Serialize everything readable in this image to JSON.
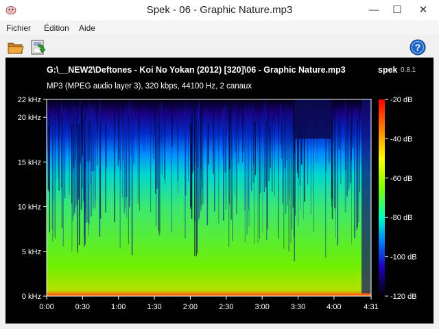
{
  "window": {
    "title": "Spek - 06 - Graphic Nature.mp3",
    "minimize_glyph": "—",
    "maximize_glyph": "☐",
    "close_glyph": "✕"
  },
  "menu": {
    "items": [
      "Fichier",
      "Édition",
      "Aide"
    ]
  },
  "toolbar": {
    "open_icon": "folder-open-icon",
    "save_icon": "save-icon",
    "help_icon": "help-icon"
  },
  "colors": {
    "canvas_bg": "#000000",
    "text": "#ffffff",
    "help_blue": "#1e64c8"
  },
  "spectrogram": {
    "file_path": "G:\\__NEW2\\Deftones - Koi No Yokan (2012) [320]\\06 - Graphic Nature.mp3",
    "app_name": "spek",
    "app_version": "0.8.1",
    "file_info": "MP3 (MPEG audio layer 3), 320 kbps, 44100 Hz, 2 canaux"
  },
  "chart_data": {
    "type": "heatmap",
    "x_ticks": [
      "0:00",
      "0:30",
      "1:00",
      "1:30",
      "2:00",
      "2:30",
      "3:00",
      "3:30",
      "4:00",
      "4:31"
    ],
    "x_tick_seconds": [
      0,
      30,
      60,
      90,
      120,
      150,
      180,
      210,
      240,
      271
    ],
    "xlim_seconds": [
      0,
      271
    ],
    "y_ticks": [
      "0 kHz",
      "5 kHz",
      "10 kHz",
      "15 kHz",
      "20 kHz",
      "22 kHz"
    ],
    "y_tick_khz": [
      0,
      5,
      10,
      15,
      20,
      22
    ],
    "ylim_khz": [
      0,
      22
    ],
    "colorbar_ticks": [
      "-20 dB",
      "-40 dB",
      "-60 dB",
      "-80 dB",
      "-100 dB",
      "-120 dB"
    ],
    "colorbar_db": [
      -20,
      -40,
      -60,
      -80,
      -100,
      -120
    ],
    "clim_db": [
      -120,
      -20
    ]
  }
}
